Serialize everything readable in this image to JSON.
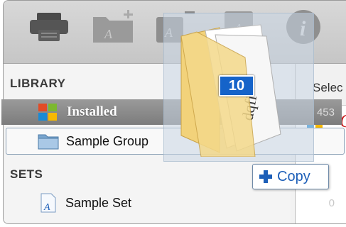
{
  "sidebar": {
    "library_heading": "LIBRARY",
    "sets_heading": "SETS",
    "items": [
      {
        "label": "Installed",
        "count": "453"
      },
      {
        "label": "Sample Group",
        "count": ""
      },
      {
        "label": "Sample Set",
        "count": "0"
      }
    ]
  },
  "right_pane": {
    "header_text": "Selec"
  },
  "drag": {
    "count_badge": "10",
    "action_label": "Copy"
  },
  "toolbar": {
    "icons": [
      "printer-icon",
      "new-folder-icon",
      "remove-font-icon",
      "font-icon",
      "info-icon"
    ]
  },
  "colors": {
    "badge_blue": "#1563c9",
    "copy_blue": "#1d5fb8",
    "folder_yellow": "#f4d98a"
  }
}
